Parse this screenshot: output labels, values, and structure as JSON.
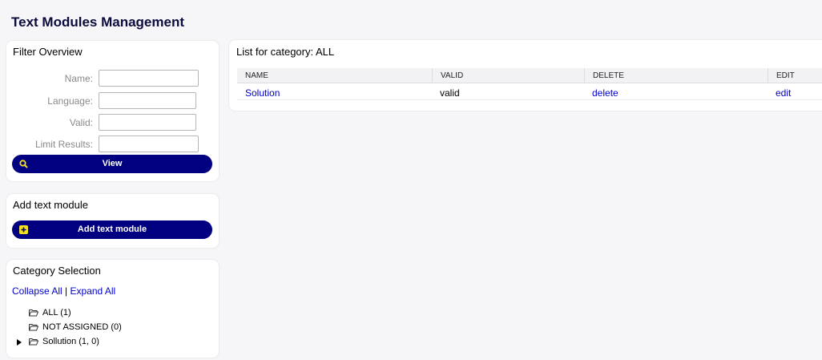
{
  "page": {
    "title": "Text Modules Management"
  },
  "filter": {
    "title": "Filter Overview",
    "fields": [
      {
        "label": "Name:",
        "value": ""
      },
      {
        "label": "Language:",
        "value": ""
      },
      {
        "label": "Valid:",
        "value": ""
      },
      {
        "label": "Limit Results:",
        "value": ""
      }
    ],
    "view_label": "View"
  },
  "add": {
    "title": "Add text module",
    "button_label": "Add text module"
  },
  "categories": {
    "title": "Category Selection",
    "collapse_all": "Collapse All",
    "separator": "|",
    "expand_all": "Expand All",
    "items": [
      {
        "label": "ALL (1)"
      },
      {
        "label": "NOT ASSIGNED (0)"
      },
      {
        "label": "Sollution (1, 0)"
      }
    ]
  },
  "list": {
    "title": "List for category: ALL",
    "columns": [
      "NAME",
      "VALID",
      "DELETE",
      "EDIT"
    ],
    "rows": [
      {
        "name": "Solution",
        "valid": "valid",
        "delete": "delete",
        "edit": "edit"
      }
    ]
  },
  "colors": {
    "button_bg": "#000080",
    "icon_yellow": "#f5e11b",
    "link": "#0000cc",
    "title": "#0b0b3b"
  }
}
